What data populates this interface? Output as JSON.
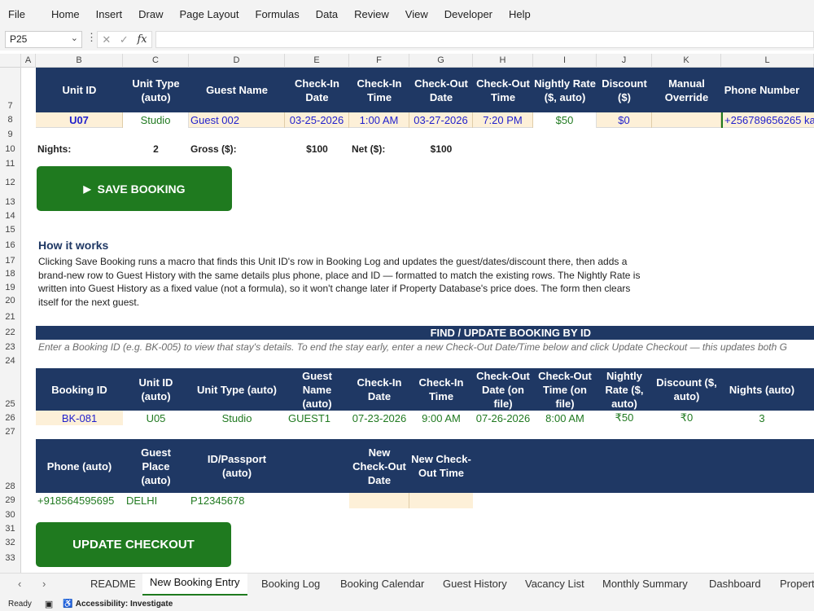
{
  "menu": [
    "File",
    "Home",
    "Insert",
    "Draw",
    "Page Layout",
    "Formulas",
    "Data",
    "Review",
    "View",
    "Developer",
    "Help"
  ],
  "namebox": "P25",
  "columns": [
    "A",
    "B",
    "C",
    "D",
    "E",
    "F",
    "G",
    "H",
    "I",
    "J",
    "K",
    "L"
  ],
  "form": {
    "headers": [
      "Unit ID",
      "Unit Type (auto)",
      "Guest Name",
      "Check-In Date",
      "Check-In Time",
      "Check-Out Date",
      "Check-Out Time",
      "Nightly Rate ($, auto)",
      "Discount ($)",
      "Manual Override",
      "Phone Number"
    ],
    "values": {
      "unit_id": "U07",
      "unit_type": "Studio",
      "guest_name": "Guest 002",
      "checkin_date": "03-25-2026",
      "checkin_time": "1:00 AM",
      "checkout_date": "03-27-2026",
      "checkout_time": "7:20 PM",
      "rate": "$50",
      "discount": "$0",
      "override": "",
      "phone": "+256789656265",
      "extra": "ka"
    },
    "nights_label": "Nights:",
    "nights": "2",
    "gross_label": "Gross ($):",
    "gross": "$100",
    "net_label": "Net ($):",
    "net": "$100"
  },
  "save_button": "SAVE BOOKING",
  "how": {
    "title": "How it works",
    "lines": [
      "Clicking Save Booking runs a macro that finds this Unit ID's row in Booking Log and updates the guest/dates/discount there, then adds a",
      "brand-new row to Guest History with the same details plus phone, place and ID — formatted to match the existing rows. The Nightly Rate is",
      "written into Guest History as a fixed value (not a formula), so it won't change later if Property Database's price does. The form then clears",
      "itself for the next guest."
    ]
  },
  "find": {
    "title": "FIND / UPDATE BOOKING BY ID",
    "note": "Enter a Booking ID (e.g. BK-005) to view that stay's details. To end the stay early, enter a new Check-Out Date/Time below and click Update Checkout — this updates both G",
    "headers": [
      "Booking ID",
      "Unit ID (auto)",
      "Unit Type (auto)",
      "Guest Name (auto)",
      "Check-In Date",
      "Check-In Time",
      "Check-Out Date (on file)",
      "Check-Out Time (on file)",
      "Nightly Rate ($, auto)",
      "Discount ($, auto)",
      "Nights (auto)"
    ],
    "values": [
      "BK-081",
      "U05",
      "Studio",
      "GUEST1",
      "07-23-2026",
      "9:00 AM",
      "07-26-2026",
      "8:00 AM",
      "₹50",
      "₹0",
      "3"
    ],
    "headers2": [
      "Phone (auto)",
      "Guest Place (auto)",
      "ID/Passport (auto)",
      "",
      "New Check-Out Date",
      "New Check-Out Time"
    ],
    "values2": [
      "+918564595695",
      "DELHI",
      "P12345678"
    ]
  },
  "update_button": "UPDATE CHECKOUT",
  "tabs": [
    "README",
    "New Booking Entry",
    "Booking Log",
    "Booking Calendar",
    "Guest History",
    "Vacancy List",
    "Monthly Summary",
    "Dashboard",
    "Propert"
  ],
  "status": {
    "ready": "Ready",
    "accessibility": "Accessibility: Investigate"
  }
}
